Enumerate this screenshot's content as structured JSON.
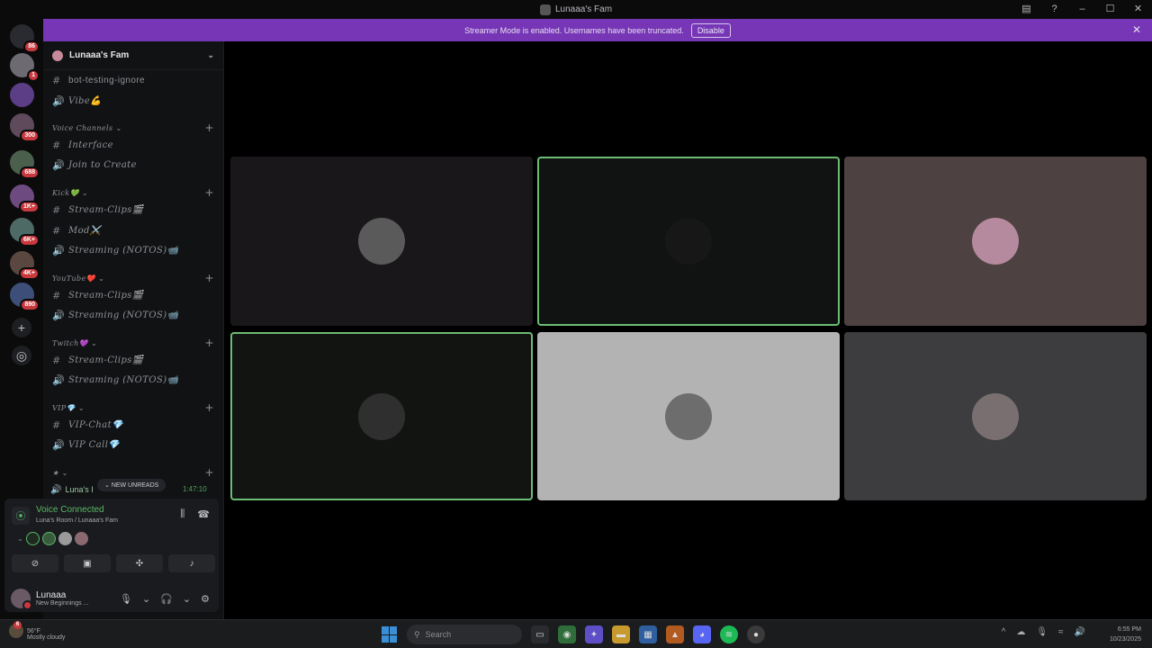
{
  "window": {
    "title": "Lunaaa's Fam"
  },
  "guild_rail": {
    "home_badge": "86",
    "badges": [
      "1",
      "300",
      "688",
      "1K+",
      "6K+",
      "4K+",
      "890"
    ]
  },
  "banner": {
    "text": "Streamer Mode is enabled. Usernames have been truncated.",
    "button": "Disable"
  },
  "server": {
    "name": "Lunaaa's Fam"
  },
  "channels": [
    {
      "type": "text",
      "name": "bot-testing-ignore"
    },
    {
      "type": "voice",
      "name": "Vibe💪"
    },
    {
      "type": "category",
      "name": "Voice Channels"
    },
    {
      "type": "text",
      "name": "Interface"
    },
    {
      "type": "voice",
      "name": "Join to Create"
    },
    {
      "type": "category",
      "name": "Kick💚"
    },
    {
      "type": "text",
      "name": "Stream-Clips🎬"
    },
    {
      "type": "text",
      "name": "Mod⚔️"
    },
    {
      "type": "voice",
      "name": "Streaming (NOTOS)📹"
    },
    {
      "type": "category",
      "name": "YouTube❤️"
    },
    {
      "type": "text",
      "name": "Stream-Clips🎬"
    },
    {
      "type": "voice",
      "name": "Streaming (NOTOS)📹"
    },
    {
      "type": "category",
      "name": "Twitch💜"
    },
    {
      "type": "text",
      "name": "Stream-Clips🎬"
    },
    {
      "type": "voice",
      "name": "Streaming (NOTOS)📹"
    },
    {
      "type": "category",
      "name": "VIP💎"
    },
    {
      "type": "text",
      "name": "VIP-Chat💎"
    },
    {
      "type": "voice",
      "name": "VIP Call💎"
    },
    {
      "type": "category",
      "name": "★"
    }
  ],
  "unread": {
    "channel": "Luna's I",
    "pill": "NEW UNREADS",
    "time": "1:47:10"
  },
  "voice": {
    "title": "Voice Connected",
    "subtitle": "Luna's Room / Lunaaa's Fam"
  },
  "user": {
    "name": "Lunaaa",
    "status": "New Beginnings ..."
  },
  "stage": {
    "tiles": [
      {
        "bg": "#1a171a",
        "face": "#5a5a5a",
        "speaking": false
      },
      {
        "bg": "#101311",
        "face": "#171717",
        "speaking": true
      },
      {
        "bg": "#4e4141",
        "face": "#b58a9e",
        "speaking": false
      },
      {
        "bg": "#121412",
        "face": "#2f2f2f",
        "speaking": true
      },
      {
        "bg": "#b3b3b3",
        "face": "#6d6d6d",
        "speaking": false
      },
      {
        "bg": "#3d3d40",
        "face": "#7a6f70",
        "speaking": false
      }
    ]
  },
  "taskbar": {
    "temp": "56°F",
    "weather": "Mostly cloudy",
    "weather_badge": "6",
    "search_placeholder": "Search",
    "time": "6:55 PM",
    "date": "10/23/2025"
  }
}
